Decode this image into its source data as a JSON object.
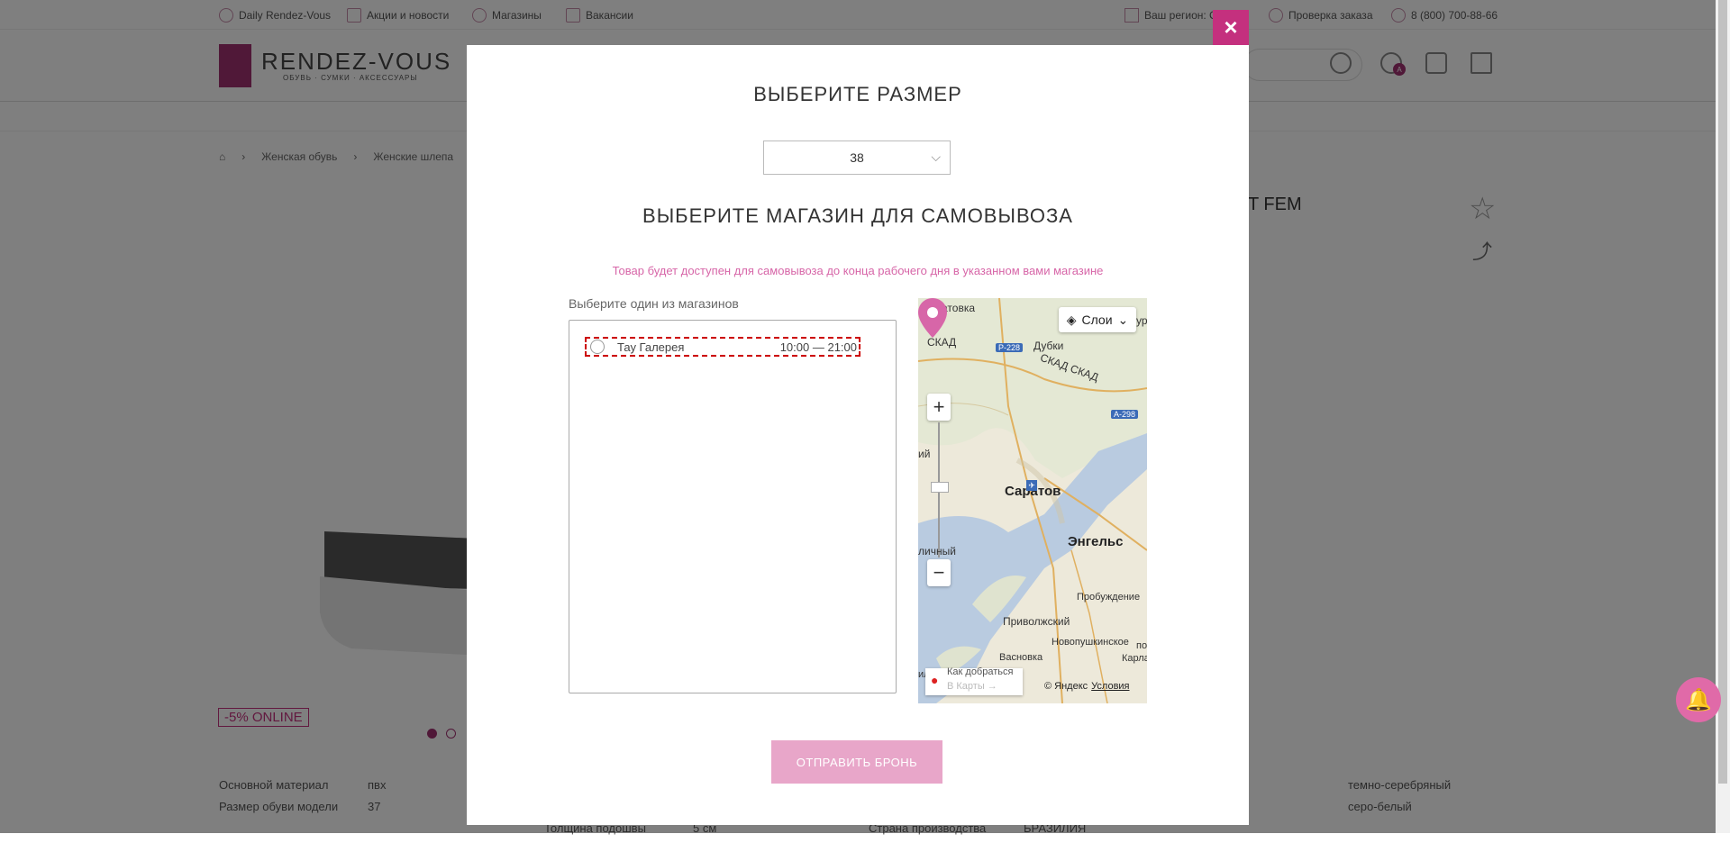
{
  "topbar": {
    "daily": "Daily Rendez-Vous",
    "promo": "Акции и новости",
    "stores": "Магазины",
    "jobs": "Вакансии",
    "region": "Ваш регион: С",
    "order_check": "Проверка заказа",
    "phone": "8 (800) 700-88-66"
  },
  "header": {
    "logo": "RENDEZ-VOUS",
    "logo_sub": "ОБУВЬ · СУМКИ · АКСЕССУАРЫ",
    "account_badge": "A"
  },
  "breadcrumbs": [
    "Женская обувь",
    "Женские шлепа"
  ],
  "product": {
    "title_fragment": "T FEM",
    "badge": "-5% ONLINE",
    "props_left": [
      {
        "k": "Основной материал",
        "v": "пвх"
      },
      {
        "k": "Размер обуви модели",
        "v": "37"
      }
    ],
    "props_bottom": [
      {
        "k": "Толщина подошвы",
        "v": "5 см"
      },
      {
        "k": "Страна производства",
        "v": "БРАЗИЛИЯ"
      }
    ],
    "props_right": [
      "темно-серебряный",
      "серо-белый"
    ]
  },
  "modal": {
    "close_label": "×",
    "size_title": "ВЫБЕРИТЕ РАЗМЕР",
    "size_value": "38",
    "store_title": "ВЫБЕРИТЕ МАГАЗИН ДЛЯ САМОВЫВОЗА",
    "note": "Товар будет доступен для самовывоза до конца рабочего дня в указанном вами магазине",
    "list_label": "Выберите один из магазинов",
    "stores": [
      {
        "name": "Тау Галерея",
        "hours": "10:00 — 21:00"
      }
    ],
    "submit_label": "ОТПРАВИТЬ БРОНЬ"
  },
  "map": {
    "layers_label": "Слои",
    "labels": {
      "skatovka": "я Скатовка",
      "ur": "ур",
      "ckad1": "СКАД",
      "dubki": "Дубки",
      "ckad2": "СКАД СКАД",
      "saratov": "Саратов",
      "engels": "Энгельс",
      "probuzhdenie": "Пробуждение",
      "privolzhsky": "Приволжский",
      "novopushkinskoe": "Новопушкинское",
      "vasnovka": "Васновка",
      "karla": "Карла",
      "po": "по",
      "ii": "ий",
      "lichny": "личный",
      "il": "ил"
    },
    "roads": {
      "r228": "Р-228",
      "a298": "А-298"
    },
    "route_l1": "Как добраться",
    "route_l2": "В Карты →",
    "copyright": "© Яндекс",
    "terms": "Условия"
  }
}
